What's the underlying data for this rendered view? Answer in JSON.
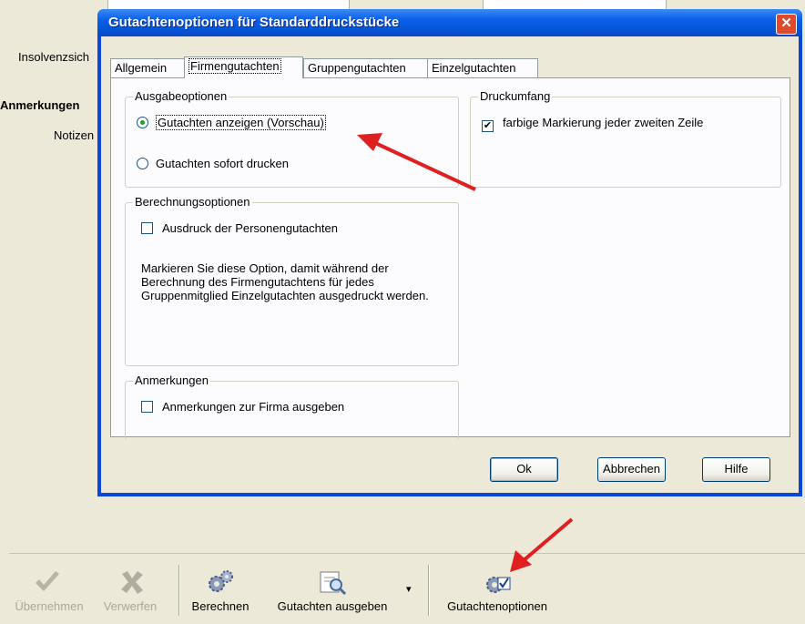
{
  "background": {
    "labels": {
      "insolvenz": "Insolvenzsich",
      "anmerkungen": "Anmerkungen",
      "notizen": "Notizen"
    }
  },
  "toolbar": {
    "uebernehmen": "Übernehmen",
    "verwerfen": "Verwerfen",
    "berechnen": "Berechnen",
    "gutachten_ausgeben": "Gutachten ausgeben",
    "dropdown_glyph": "▾",
    "gutachtenoptionen": "Gutachtenoptionen"
  },
  "dialog": {
    "title": "Gutachtenoptionen für Standarddruckstücke",
    "close_glyph": "✕",
    "tabs": [
      {
        "label": "Allgemein",
        "active": false
      },
      {
        "label": "Firmengutachten",
        "active": true
      },
      {
        "label": "Gruppengutachten",
        "active": false
      },
      {
        "label": "Einzelgutachten",
        "active": false
      }
    ],
    "ausgabeoptionen": {
      "legend": "Ausgabeoptionen",
      "option1": "Gutachten anzeigen (Vorschau)",
      "option1_selected": true,
      "option2": "Gutachten sofort drucken"
    },
    "druckumfang": {
      "legend": "Druckumfang",
      "checkbox_label": "farbige Markierung jeder zweiten Zeile",
      "checked": true
    },
    "berechnungsoptionen": {
      "legend": "Berechnungsoptionen",
      "checkbox_label": "Ausdruck der Personengutachten",
      "checked": false,
      "description": "Markieren Sie diese Option, damit während der Berechnung des Firmengutachtens für jedes Gruppenmitglied Einzelgutachten ausgedruckt werden."
    },
    "anmerkungen": {
      "legend": "Anmerkungen",
      "checkbox_label": "Anmerkungen zur Firma ausgeben",
      "checked": false
    },
    "buttons": {
      "ok": "Ok",
      "abbrechen": "Abbrechen",
      "hilfe": "Hilfe"
    }
  },
  "colors": {
    "titlebar": "#0a5ee8",
    "arrow": "#e02020",
    "face": "#ece9d8"
  }
}
